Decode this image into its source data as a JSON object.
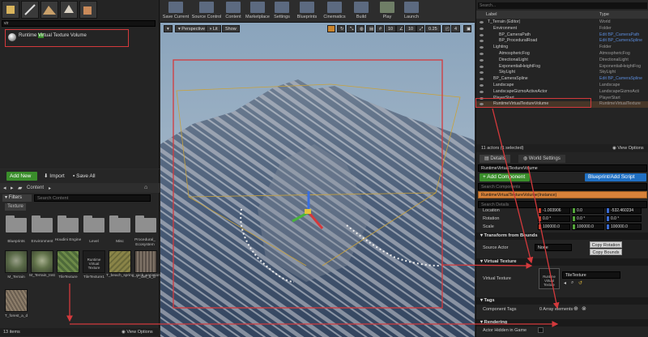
{
  "modes": {
    "search_text": "vir",
    "result_label_pre": "Runtime ",
    "result_label_hl": "Vir",
    "result_label_post": "tual Texture Volume"
  },
  "content_browser": {
    "add_new": "Add New",
    "import": "Import",
    "save_all": "Save All",
    "breadcrumb": "Content",
    "filters": "Filters",
    "search_placeholder": "Search Content",
    "path_chip": "Texture",
    "folders": [
      "Blueprints",
      "Environment",
      "Houdini Engine",
      "Level",
      "Misc",
      "Procedural_ Ecosystem"
    ],
    "assets": [
      {
        "label": "M_Terrain",
        "tile": "",
        "thumb": "terrain"
      },
      {
        "label": "M_Terrain_Inst",
        "tile": "",
        "thumb": "terrain"
      },
      {
        "label": "TileTexture",
        "tile": "",
        "thumb": "grass"
      },
      {
        "label": "TileTexture1",
        "tile": "Runtime Virtual Texture",
        "thumb": "vtex"
      },
      {
        "label": "T_beach_spring_rock_variations",
        "tile": "",
        "thumb": "moss"
      },
      {
        "label": "T_cliff_a_d",
        "tile": "",
        "thumb": "cliff"
      },
      {
        "label": "T_forest_a_d",
        "tile": "",
        "thumb": "forest"
      }
    ],
    "vt_tile_text": "Runtime Virtual Texture",
    "footer_count": "13 items",
    "view_options": "View Options"
  },
  "toolbar": {
    "buttons": [
      "Save Current",
      "Source Control",
      "Content",
      "Marketplace",
      "Settings",
      "Blueprints",
      "Cinematics",
      "Build",
      "Play",
      "Launch"
    ]
  },
  "viewport": {
    "perspective": "Perspective",
    "lit": "Lit",
    "show": "Show",
    "grid_snap": "10",
    "rot_snap": "10",
    "scale_snap": "0.25",
    "cam_speed": "4"
  },
  "outliner": {
    "search_placeholder": "Search...",
    "col_label": "Label",
    "col_type": "Type",
    "rows": [
      {
        "label": "T_Terrain (Editor)",
        "type": "World",
        "link": false,
        "indent": 0
      },
      {
        "label": "Environment",
        "type": "Folder",
        "link": false,
        "indent": 1
      },
      {
        "label": "BP_CameraPath",
        "type": "Edit BP_CameraPath",
        "link": true,
        "indent": 2
      },
      {
        "label": "BP_ProceduralRoad",
        "type": "Edit BP_CameraSpline",
        "link": true,
        "indent": 2
      },
      {
        "label": "Lighting",
        "type": "Folder",
        "link": false,
        "indent": 1
      },
      {
        "label": "AtmosphericFog",
        "type": "AtmosphericFog",
        "link": false,
        "indent": 2
      },
      {
        "label": "DirectionalLight",
        "type": "DirectionalLight",
        "link": false,
        "indent": 2
      },
      {
        "label": "ExponentialHeightFog",
        "type": "ExponentialHeightFog",
        "link": false,
        "indent": 2
      },
      {
        "label": "SkyLight",
        "type": "SkyLight",
        "link": false,
        "indent": 2
      },
      {
        "label": "BP_CameraSpline",
        "type": "Edit BP_CameraSpline",
        "link": true,
        "indent": 1
      },
      {
        "label": "Landscape",
        "type": "Landscape",
        "link": false,
        "indent": 1
      },
      {
        "label": "LandscapeGizmoActiveActor",
        "type": "LandscapeGizmoActi",
        "link": false,
        "indent": 1
      },
      {
        "label": "PlayerStart",
        "type": "PlayerStart",
        "link": false,
        "indent": 1
      },
      {
        "label": "RuntimeVirtualTextureVolume",
        "type": "RuntimeVirtualTexture",
        "link": false,
        "indent": 1
      }
    ],
    "footer_count": "11 actors (1 selected)",
    "view_options": "View Options"
  },
  "details": {
    "tab_details": "Details",
    "tab_world": "World Settings",
    "name_field": "RuntimeVirtualTextureVolume",
    "add_component": "+ Add Component",
    "blueprint_script": "Blueprint/Add Script",
    "search_components": "Search Components",
    "instance_row": "RuntimeVirtualTextureVolume(Instance)",
    "search_details": "Search Details",
    "location_label": "Location",
    "rotation_label": "Rotation",
    "scale_label": "Scale",
    "location": [
      "-1.003906",
      "0.0",
      "-532.460234"
    ],
    "rotation": [
      "0.0 °",
      "0.0 °",
      "0.0 °"
    ],
    "scale": [
      "100000.0",
      "100000.0",
      "100000.0"
    ],
    "section_transform_bounds": "Transform from Bounds",
    "source_actor_label": "Source Actor",
    "source_actor_value": "None",
    "copy_rotation": "Copy Rotation",
    "copy_bounds": "Copy Bounds",
    "section_virtual_texture": "Virtual Texture",
    "vt_label": "Virtual Texture",
    "vt_thumb_text": "Runtime Virtual Texture",
    "vt_value": "TileTexture",
    "section_tags": "Tags",
    "component_tags_label": "Component Tags",
    "component_tags_value": "0 Array elements",
    "section_rendering": "Rendering",
    "actor_hidden_label": "Actor Hidden in Game"
  },
  "colors": {
    "annotation_red": "#d4393c",
    "accent_green": "#3a8e2b",
    "accent_blue": "#1f6fc2",
    "selection_orange": "#d8823a"
  }
}
